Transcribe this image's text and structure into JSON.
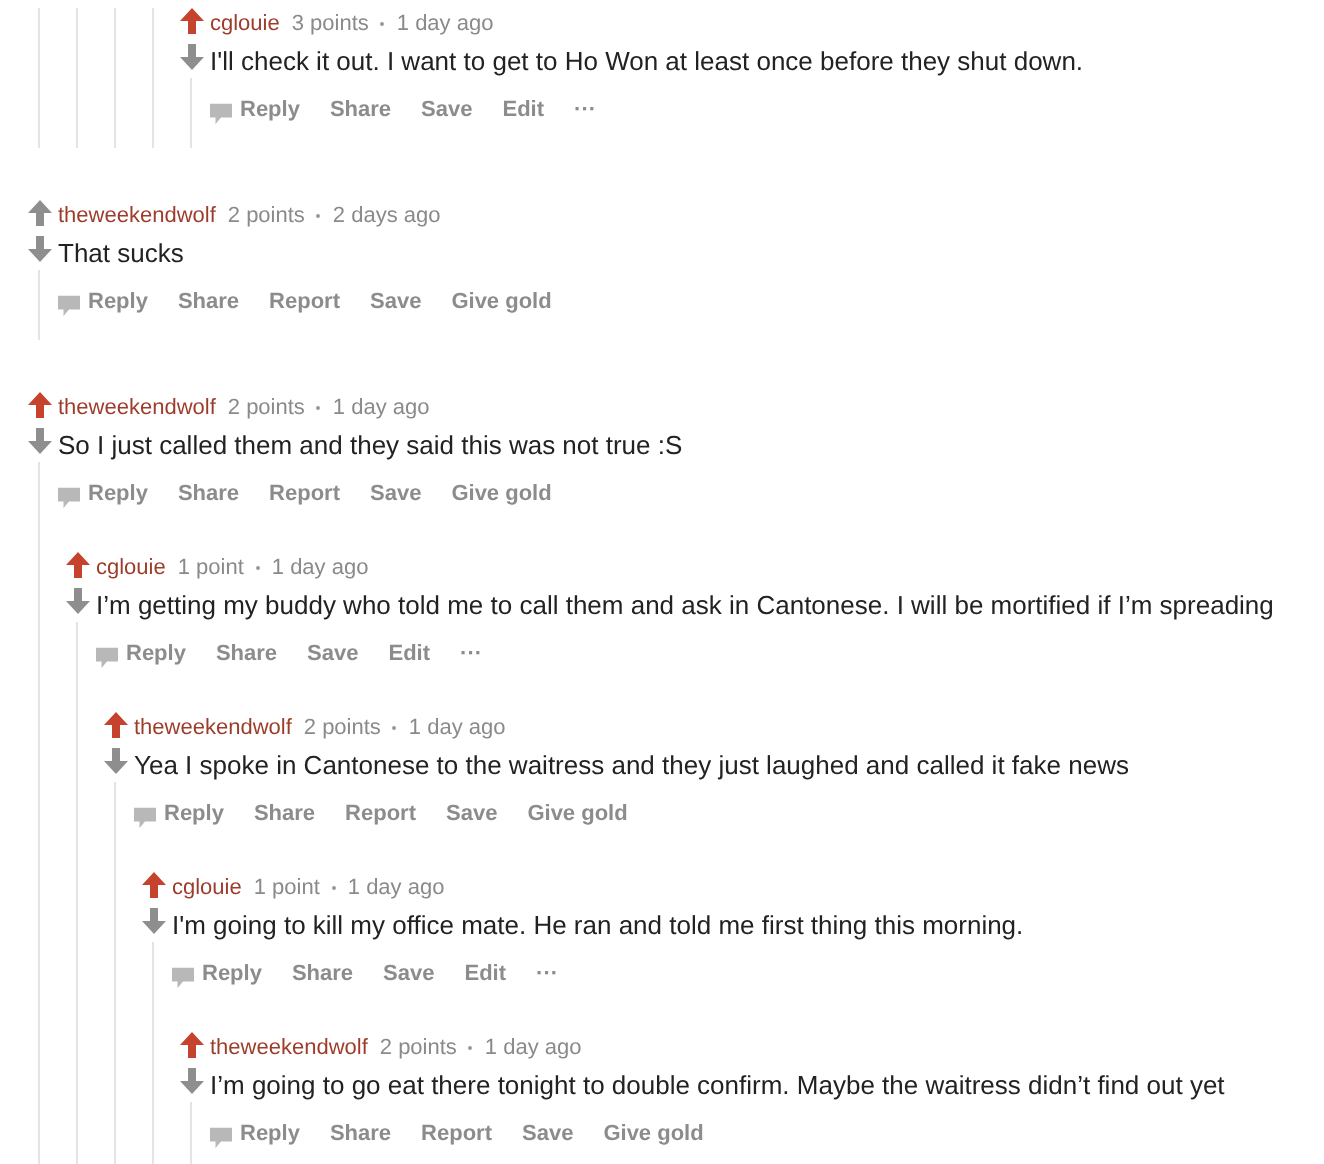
{
  "comments": [
    {
      "kind": "offscreen",
      "children": [
        {
          "kind": "offscreen",
          "children": [
            {
              "kind": "offscreen",
              "children": [
                {
                  "kind": "offscreen",
                  "children": [
                    {
                      "kind": "comment",
                      "author": "cglouie",
                      "points": "3 points",
                      "time": "1 day ago",
                      "upvoted": true,
                      "body": "I'll check it out. I want to get to Ho Won at least once before they shut down.",
                      "actions": [
                        "Reply",
                        "Share",
                        "Save",
                        "Edit",
                        "···"
                      ]
                    }
                  ]
                }
              ]
            }
          ]
        }
      ]
    },
    {
      "kind": "comment",
      "author": "theweekendwolf",
      "points": "2 points",
      "time": "2 days ago",
      "upvoted": false,
      "body": "That sucks",
      "actions": [
        "Reply",
        "Share",
        "Report",
        "Save",
        "Give gold"
      ]
    },
    {
      "kind": "comment",
      "author": "theweekendwolf",
      "points": "2 points",
      "time": "1 day ago",
      "upvoted": true,
      "body": "So I just called them and they said this was not true :S",
      "actions": [
        "Reply",
        "Share",
        "Report",
        "Save",
        "Give gold"
      ],
      "children": [
        {
          "kind": "comment",
          "author": "cglouie",
          "points": "1 point",
          "time": "1 day ago",
          "upvoted": true,
          "body": "I’m getting my buddy who told me to call them and ask in Cantonese. I will be mortified if I’m spreading",
          "actions": [
            "Reply",
            "Share",
            "Save",
            "Edit",
            "···"
          ],
          "children": [
            {
              "kind": "comment",
              "author": "theweekendwolf",
              "points": "2 points",
              "time": "1 day ago",
              "upvoted": true,
              "body": "Yea I spoke in Cantonese to the waitress and they just laughed and called it fake news",
              "actions": [
                "Reply",
                "Share",
                "Report",
                "Save",
                "Give gold"
              ],
              "children": [
                {
                  "kind": "comment",
                  "author": "cglouie",
                  "points": "1 point",
                  "time": "1 day ago",
                  "upvoted": true,
                  "body": "I'm going to kill my office mate. He ran and told me first thing this morning.",
                  "actions": [
                    "Reply",
                    "Share",
                    "Save",
                    "Edit",
                    "···"
                  ],
                  "children": [
                    {
                      "kind": "comment",
                      "author": "theweekendwolf",
                      "points": "2 points",
                      "time": "1 day ago",
                      "upvoted": true,
                      "body": "I’m going to go eat there tonight to double confirm. Maybe the waitress didn’t find out yet",
                      "actions": [
                        "Reply",
                        "Share",
                        "Report",
                        "Save",
                        "Give gold"
                      ]
                    }
                  ]
                }
              ]
            }
          ]
        }
      ]
    }
  ]
}
